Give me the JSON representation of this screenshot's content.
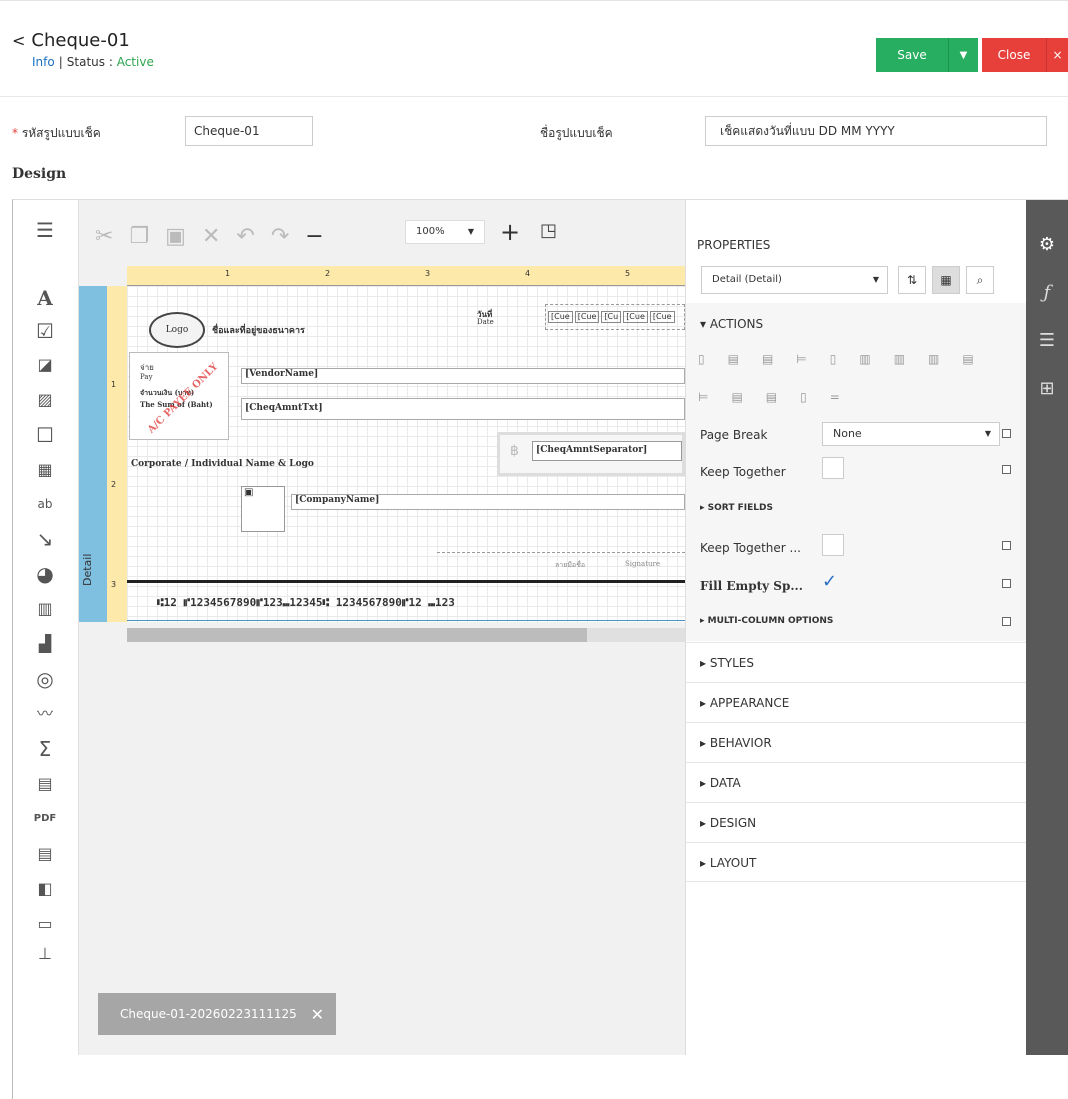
{
  "header": {
    "back_icon": "chevron-left-icon",
    "title": "Cheque-01",
    "info": "Info",
    "status_label": "Status :",
    "status_value": "Active",
    "save": "Save",
    "close": "Close"
  },
  "form": {
    "code_label": "รหัสรูปแบบเช็ค",
    "code_value": "Cheque-01",
    "name_label": "ชื่อรูปแบบเช็ค",
    "name_value": "เช็คแสดงวันที่แบบ DD MM YYYY",
    "design": "Design"
  },
  "toolbar": {
    "zoom": "100%"
  },
  "canvas": {
    "band": "Detail",
    "ruler": [
      "1",
      "2",
      "3",
      "4",
      "5"
    ],
    "vruler": [
      "1",
      "2",
      "3"
    ],
    "logo": "Logo",
    "bank_name": "ชื่อและที่อยู่ของธนาคาร",
    "date_th": "วันที่",
    "date_en": "Date",
    "date_fields": [
      "[Cue",
      "[Cue",
      "[Cu",
      "[Cue",
      "[Cue"
    ],
    "pay_th": "จ่าย",
    "pay_en": "Pay",
    "amount_th": "จำนวนเงิน (บาท)",
    "amount_en": "The Sum of (Baht)",
    "stamp": "A/C PAYEE ONLY",
    "vendor": "[VendorName]",
    "amount_txt": "[CheqAmntTxt]",
    "corporate": "Corporate / Individual Name & Logo",
    "baht_symbol": "฿",
    "amount_sep": "[CheqAmntSeparator]",
    "company": "[CompanyName]",
    "signature_th": "ลายมือชื่อ",
    "signature_en": "Signature",
    "micr": "⑆12 ⑈1234567890⑈123⑉12345⑆ 1234567890⑈12 ⑉123"
  },
  "toast": "Cheque-01-20260223111125",
  "properties": {
    "title": "PROPERTIES",
    "selector": "Detail (Detail)",
    "actions": "ACTIONS",
    "page_break_label": "Page Break",
    "page_break_value": "None",
    "keep_together": "Keep Together",
    "sort_fields": "SORT FIELDS",
    "keep_together_group": "Keep Together ...",
    "fill_empty": "Fill Empty Sp...",
    "multi_column": "MULTI-COLUMN OPTIONS",
    "sections": [
      "STYLES",
      "APPEARANCE",
      "BEHAVIOR",
      "DATA",
      "DESIGN",
      "LAYOUT"
    ]
  },
  "colors": {
    "save": "#27ae60",
    "close": "#e7403b",
    "active": "#2da44e",
    "link": "#1a6fc1",
    "ruler": "#fde9a9",
    "band": "#7fbfe0"
  }
}
